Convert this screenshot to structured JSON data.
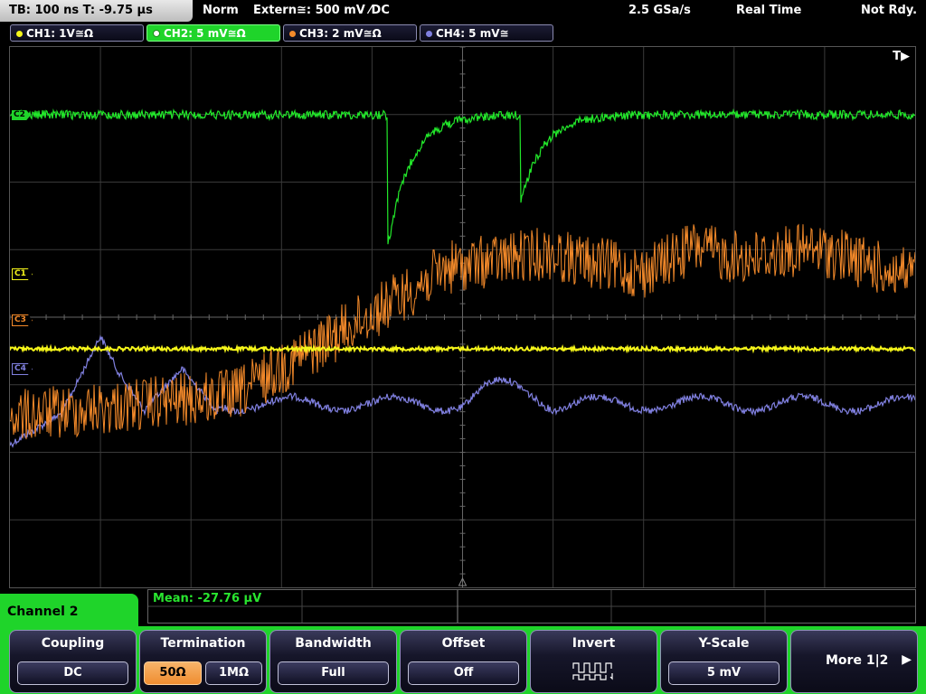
{
  "topbar": {
    "timebase": "TB: 100 ns   T: -9.75 µs",
    "mode": "Norm",
    "trigger": "Extern≅: 500 mV ⁄DC",
    "sample_rate": "2.5 GSa/s",
    "acq_mode": "Real Time",
    "status": "Not Rdy."
  },
  "channels": [
    {
      "label": "CH1: 1V≅Ω",
      "color": "#f5f51a"
    },
    {
      "label": "CH2: 5 mV≅Ω",
      "color": "#22e82a"
    },
    {
      "label": "CH3: 2 mV≅Ω",
      "color": "#f48a2a"
    },
    {
      "label": "CH4: 5 mV≅",
      "color": "#8080e0"
    }
  ],
  "markers": {
    "c1": "C1",
    "c2": "C2",
    "c3": "C3",
    "c4": "C4",
    "trigger": "T▶"
  },
  "measurement": {
    "text": "Mean: -27.76 µV"
  },
  "panel": {
    "title": "Channel 2"
  },
  "softkeys": {
    "coupling": {
      "title": "Coupling",
      "value": "DC"
    },
    "termination": {
      "title": "Termination",
      "opt1": "50Ω",
      "opt2": "1MΩ"
    },
    "bandwidth": {
      "title": "Bandwidth",
      "value": "Full"
    },
    "offset": {
      "title": "Offset",
      "value": "Off"
    },
    "invert": {
      "title": "Invert",
      "icon": "square-wave-icon"
    },
    "yscale": {
      "title": "Y-Scale",
      "value": "5 mV"
    },
    "more": {
      "label": "More 1|2"
    }
  }
}
